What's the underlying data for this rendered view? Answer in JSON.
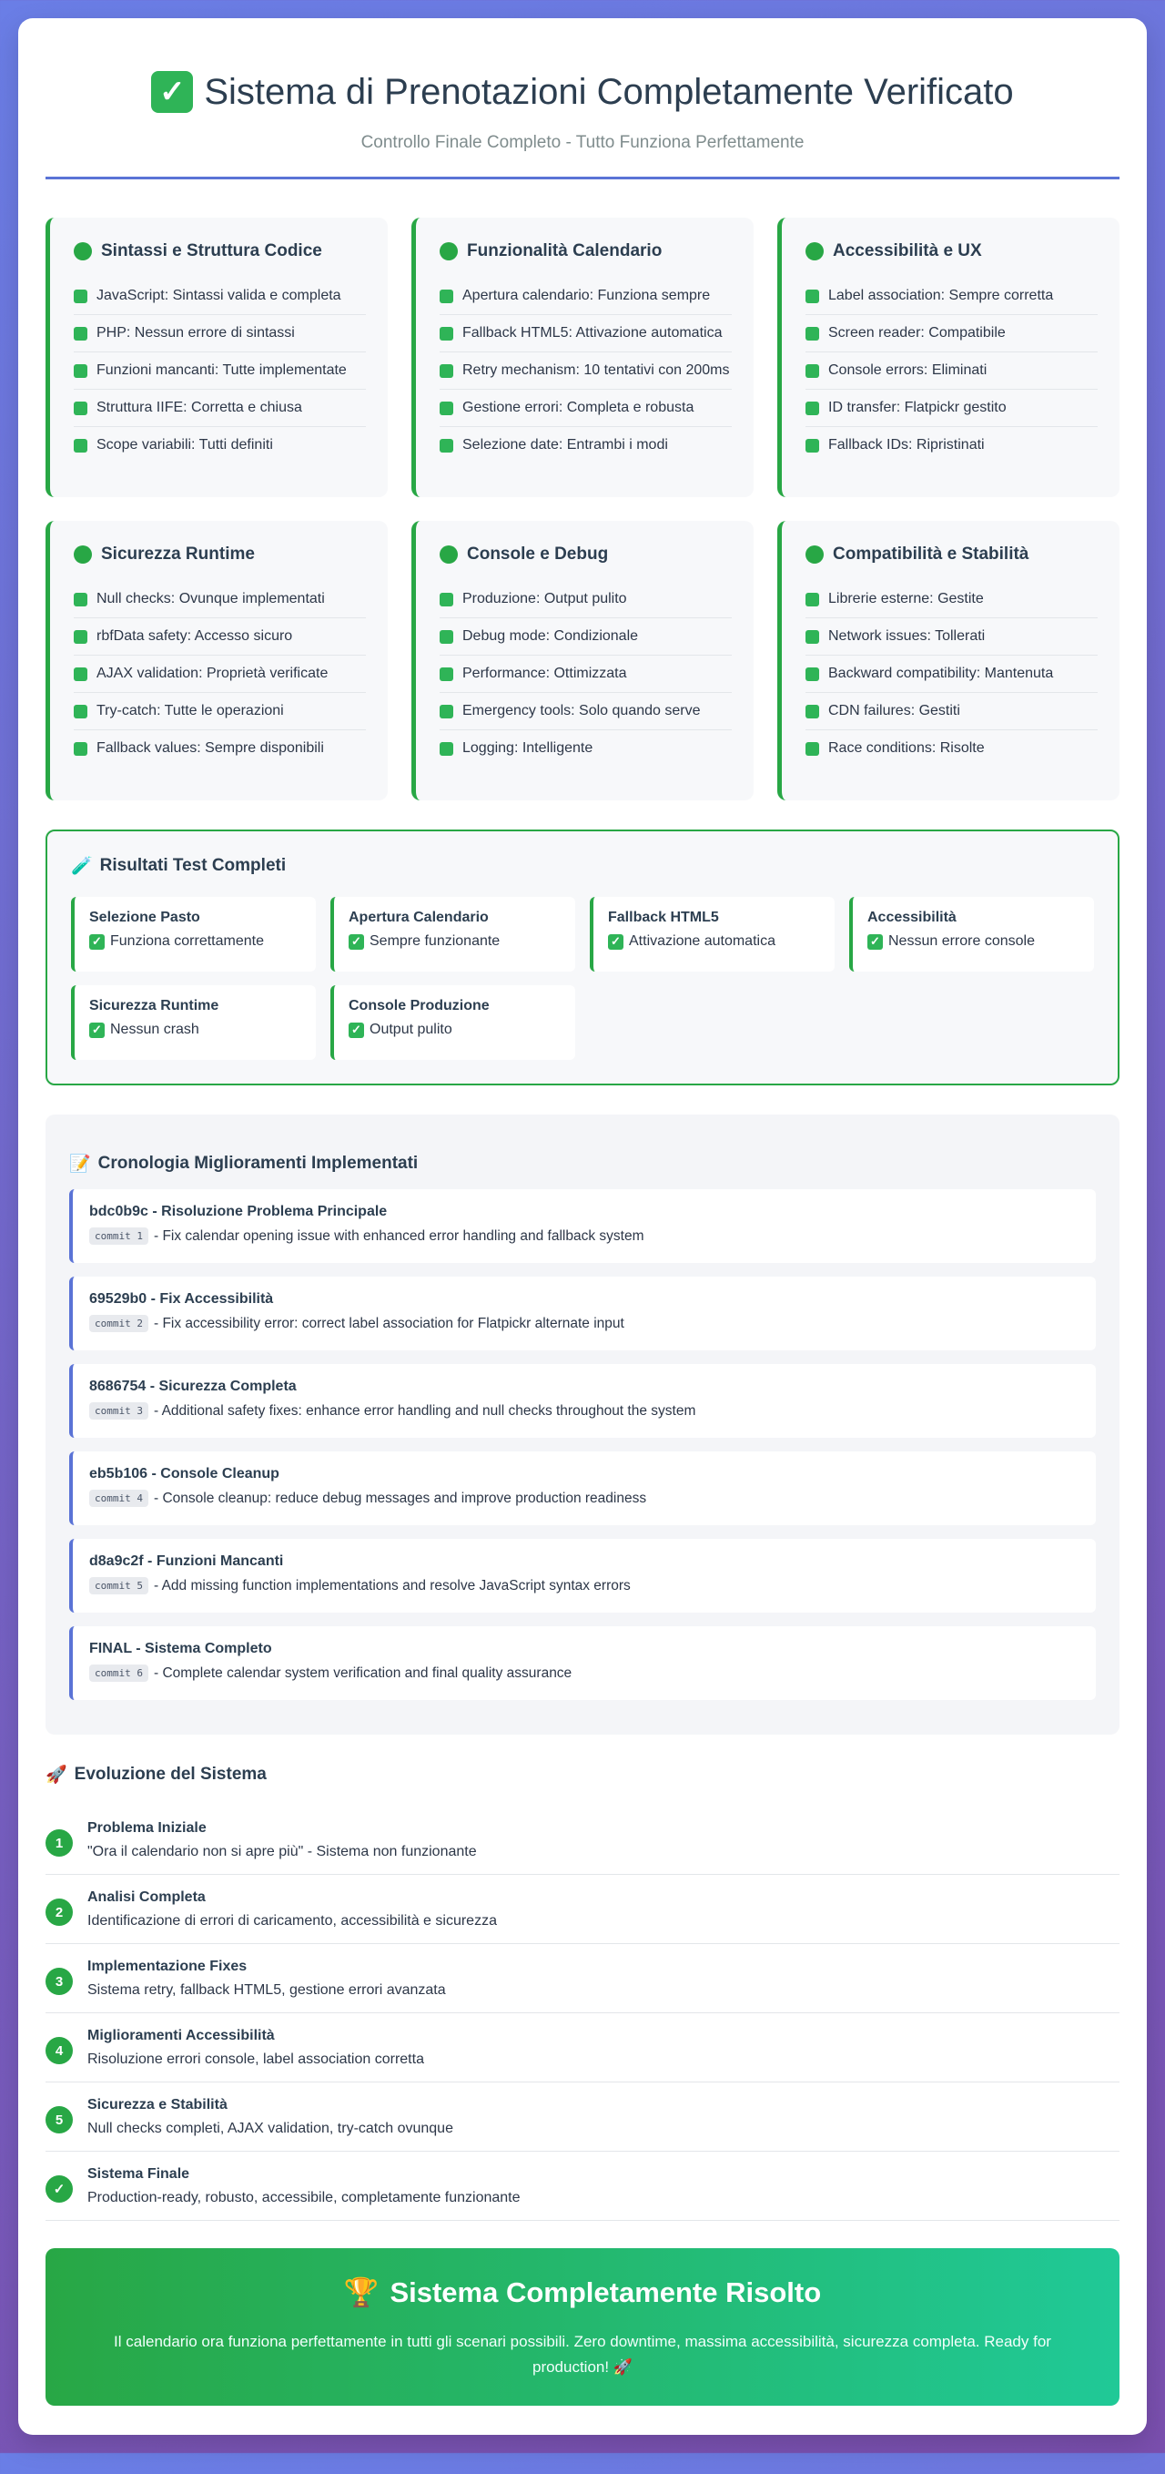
{
  "header": {
    "title": "Sistema di Prenotazioni Completamente Verificato",
    "subtitle": "Controllo Finale Completo - Tutto Funziona Perfettamente",
    "title_icon": "check-box-icon"
  },
  "cards": [
    {
      "title": "Sintassi e Struttura Codice",
      "items": [
        "JavaScript: Sintassi valida e completa",
        "PHP: Nessun errore di sintassi",
        "Funzioni mancanti: Tutte implementate",
        "Struttura IIFE: Corretta e chiusa",
        "Scope variabili: Tutti definiti"
      ]
    },
    {
      "title": "Funzionalità Calendario",
      "items": [
        "Apertura calendario: Funziona sempre",
        "Fallback HTML5: Attivazione automatica",
        "Retry mechanism: 10 tentativi con 200ms",
        "Gestione errori: Completa e robusta",
        "Selezione date: Entrambi i modi"
      ]
    },
    {
      "title": "Accessibilità e UX",
      "items": [
        "Label association: Sempre corretta",
        "Screen reader: Compatibile",
        "Console errors: Eliminati",
        "ID transfer: Flatpickr gestito",
        "Fallback IDs: Ripristinati"
      ]
    },
    {
      "title": "Sicurezza Runtime",
      "items": [
        "Null checks: Ovunque implementati",
        "rbfData safety: Accesso sicuro",
        "AJAX validation: Proprietà verificate",
        "Try-catch: Tutte le operazioni",
        "Fallback values: Sempre disponibili"
      ]
    },
    {
      "title": "Console e Debug",
      "items": [
        "Produzione: Output pulito",
        "Debug mode: Condizionale",
        "Performance: Ottimizzata",
        "Emergency tools: Solo quando serve",
        "Logging: Intelligente"
      ]
    },
    {
      "title": "Compatibilità e Stabilità",
      "items": [
        "Librerie esterne: Gestite",
        "Network issues: Tollerati",
        "Backward compatibility: Mantenuta",
        "CDN failures: Gestiti",
        "Race conditions: Risolte"
      ]
    }
  ],
  "results": {
    "title": "Risultati Test Completi",
    "icon": "test-tube-icon",
    "items": [
      {
        "title": "Selezione Pasto",
        "status": "Funziona correttamente"
      },
      {
        "title": "Apertura Calendario",
        "status": "Sempre funzionante"
      },
      {
        "title": "Fallback HTML5",
        "status": "Attivazione automatica"
      },
      {
        "title": "Accessibilità",
        "status": "Nessun errore console"
      },
      {
        "title": "Sicurezza Runtime",
        "status": "Nessun crash"
      },
      {
        "title": "Console Produzione",
        "status": "Output pulito"
      }
    ]
  },
  "history": {
    "title": "Cronologia Miglioramenti Implementati",
    "icon": "memo-icon",
    "commits": [
      {
        "title": "bdc0b9c - Risoluzione Problema Principale",
        "tag": "commit 1",
        "desc": "- Fix calendar opening issue with enhanced error handling and fallback system"
      },
      {
        "title": "69529b0 - Fix Accessibilità",
        "tag": "commit 2",
        "desc": "- Fix accessibility error: correct label association for Flatpickr alternate input"
      },
      {
        "title": "8686754 - Sicurezza Completa",
        "tag": "commit 3",
        "desc": "- Additional safety fixes: enhance error handling and null checks throughout the system"
      },
      {
        "title": "eb5b106 - Console Cleanup",
        "tag": "commit 4",
        "desc": "- Console cleanup: reduce debug messages and improve production readiness"
      },
      {
        "title": "d8a9c2f - Funzioni Mancanti",
        "tag": "commit 5",
        "desc": "- Add missing function implementations and resolve JavaScript syntax errors"
      },
      {
        "title": "FINAL - Sistema Completo",
        "tag": "commit 6",
        "desc": "- Complete calendar system verification and final quality assurance"
      }
    ]
  },
  "evolution": {
    "title": "Evoluzione del Sistema",
    "icon": "rocket-icon",
    "steps": [
      {
        "num": "1",
        "title": "Problema Iniziale",
        "desc": "\"Ora il calendario non si apre più\" - Sistema non funzionante"
      },
      {
        "num": "2",
        "title": "Analisi Completa",
        "desc": "Identificazione di errori di caricamento, accessibilità e sicurezza"
      },
      {
        "num": "3",
        "title": "Implementazione Fixes",
        "desc": "Sistema retry, fallback HTML5, gestione errori avanzata"
      },
      {
        "num": "4",
        "title": "Miglioramenti Accessibilità",
        "desc": "Risoluzione errori console, label association corretta"
      },
      {
        "num": "5",
        "title": "Sicurezza e Stabilità",
        "desc": "Null checks completi, AJAX validation, try-catch ovunque"
      },
      {
        "num": "✓",
        "title": "Sistema Finale",
        "desc": "Production-ready, robusto, accessibile, completamente funzionante"
      }
    ]
  },
  "banner": {
    "title": "Sistema Completamente Risolto",
    "icon": "trophy-icon",
    "text": "Il calendario ora funziona perfettamente in tutti gli scenari possibili. Zero downtime, massima accessibilità, sicurezza completa. Ready for production! 🚀"
  },
  "colors": {
    "accent_green": "#28a745",
    "accent_blue": "#5a73d6",
    "banner_gradient_end": "#20c997"
  }
}
